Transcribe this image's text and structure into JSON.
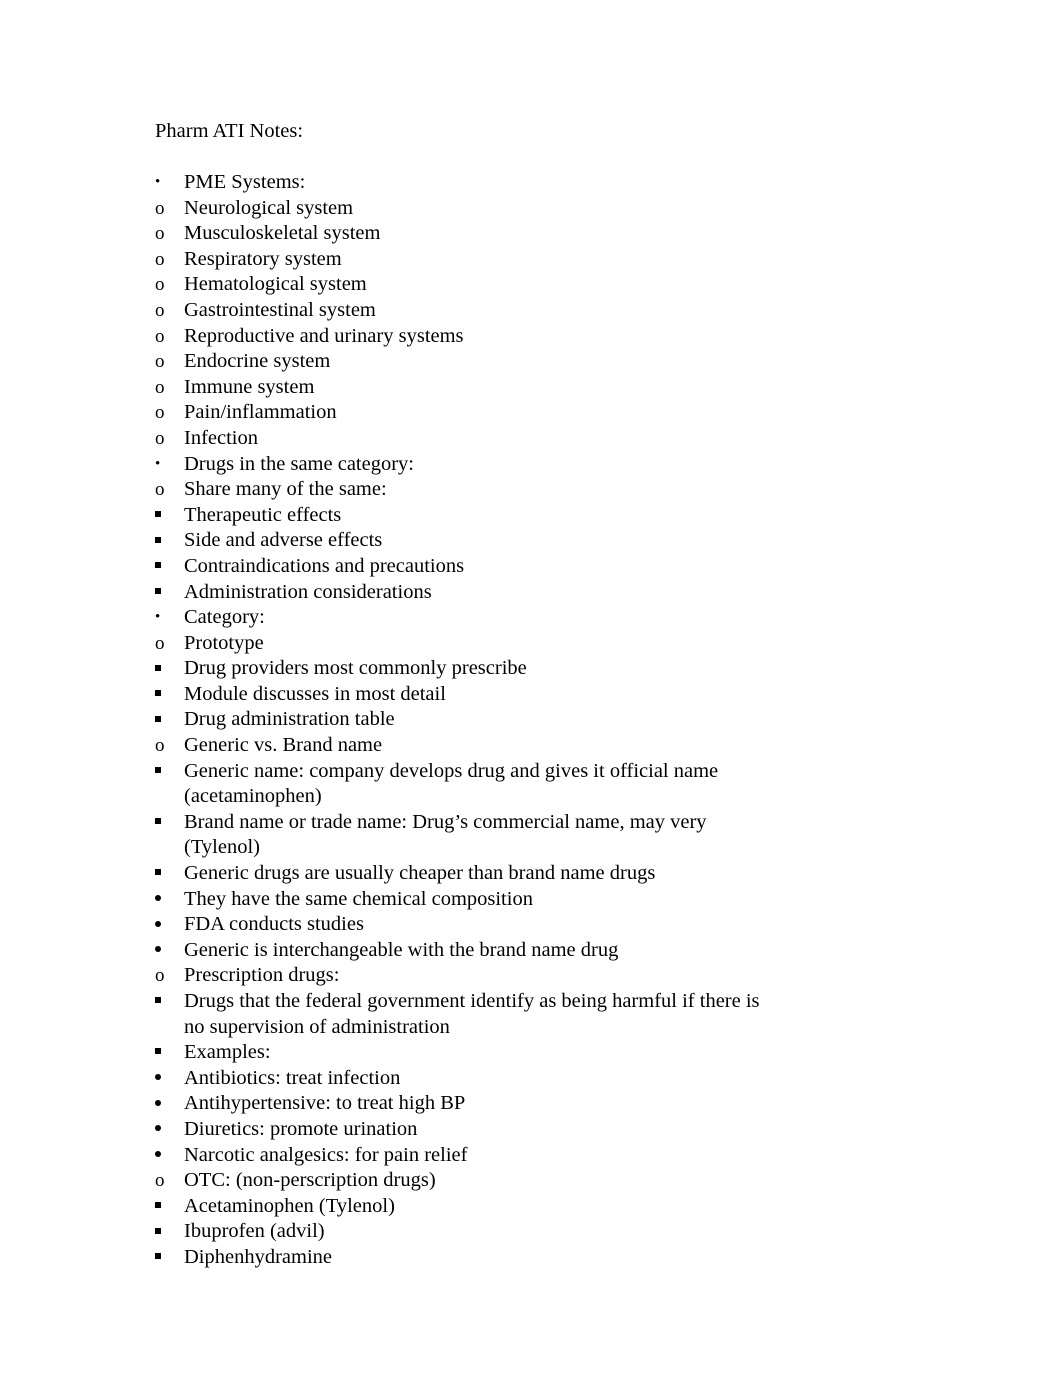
{
  "document": {
    "title": "Pharm ATI Notes:",
    "bullet_glyphs": {
      "level1": "•",
      "level2": "o",
      "level3": "square",
      "level4": "dot"
    },
    "outline": [
      {
        "level": 1,
        "text": "PME Systems:",
        "children": [
          {
            "level": 2,
            "text": "Neurological system"
          },
          {
            "level": 2,
            "text": "Musculoskeletal system"
          },
          {
            "level": 2,
            "text": "Respiratory system"
          },
          {
            "level": 2,
            "text": "Hematological system"
          },
          {
            "level": 2,
            "text": "Gastrointestinal system"
          },
          {
            "level": 2,
            "text": "Reproductive and urinary systems"
          },
          {
            "level": 2,
            "text": "Endocrine system"
          },
          {
            "level": 2,
            "text": "Immune system"
          },
          {
            "level": 2,
            "text": "Pain/inflammation"
          },
          {
            "level": 2,
            "text": "Infection"
          }
        ]
      },
      {
        "level": 1,
        "text": "Drugs in the same category:",
        "children": [
          {
            "level": 2,
            "text": "Share many of the same:",
            "children": [
              {
                "level": 3,
                "text": "Therapeutic effects"
              },
              {
                "level": 3,
                "text": "Side and adverse effects"
              },
              {
                "level": 3,
                "text": "Contraindications and precautions"
              },
              {
                "level": 3,
                "text": "Administration considerations"
              }
            ]
          }
        ]
      },
      {
        "level": 1,
        "text": "Category:",
        "children": [
          {
            "level": 2,
            "text": "Prototype",
            "children": [
              {
                "level": 3,
                "text": "Drug providers most commonly prescribe"
              },
              {
                "level": 3,
                "text": "Module discusses in most detail"
              },
              {
                "level": 3,
                "text": "Drug administration table"
              }
            ]
          },
          {
            "level": 2,
            "text": "Generic vs. Brand name",
            "children": [
              {
                "level": 3,
                "text": "Generic name: company develops drug and gives it official name (acetaminophen)"
              },
              {
                "level": 3,
                "text": "Brand name or trade name: Drug’s commercial name, may very (Tylenol)"
              },
              {
                "level": 3,
                "text": "Generic drugs are usually cheaper than brand name drugs",
                "children": [
                  {
                    "level": 4,
                    "text": "They have the same chemical composition"
                  },
                  {
                    "level": 4,
                    "text": "FDA conducts studies"
                  },
                  {
                    "level": 4,
                    "text": "Generic is interchangeable with the brand name drug"
                  }
                ]
              }
            ]
          },
          {
            "level": 2,
            "text": "Prescription drugs:",
            "children": [
              {
                "level": 3,
                "text": "Drugs that the federal government identify as being harmful if there is no supervision of administration"
              },
              {
                "level": 3,
                "text": "Examples:",
                "children": [
                  {
                    "level": 4,
                    "text": "Antibiotics: treat infection"
                  },
                  {
                    "level": 4,
                    "text": "Antihypertensive: to treat high BP"
                  },
                  {
                    "level": 4,
                    "text": "Diuretics: promote urination"
                  },
                  {
                    "level": 4,
                    "text": "Narcotic analgesics: for pain relief"
                  }
                ]
              }
            ]
          },
          {
            "level": 2,
            "text": "OTC: (non-perscription drugs)",
            "children": [
              {
                "level": 3,
                "text": "Acetaminophen (Tylenol)"
              },
              {
                "level": 3,
                "text": "Ibuprofen (advil)"
              },
              {
                "level": 3,
                "text": "Diphenhydramine"
              }
            ]
          }
        ]
      }
    ]
  }
}
